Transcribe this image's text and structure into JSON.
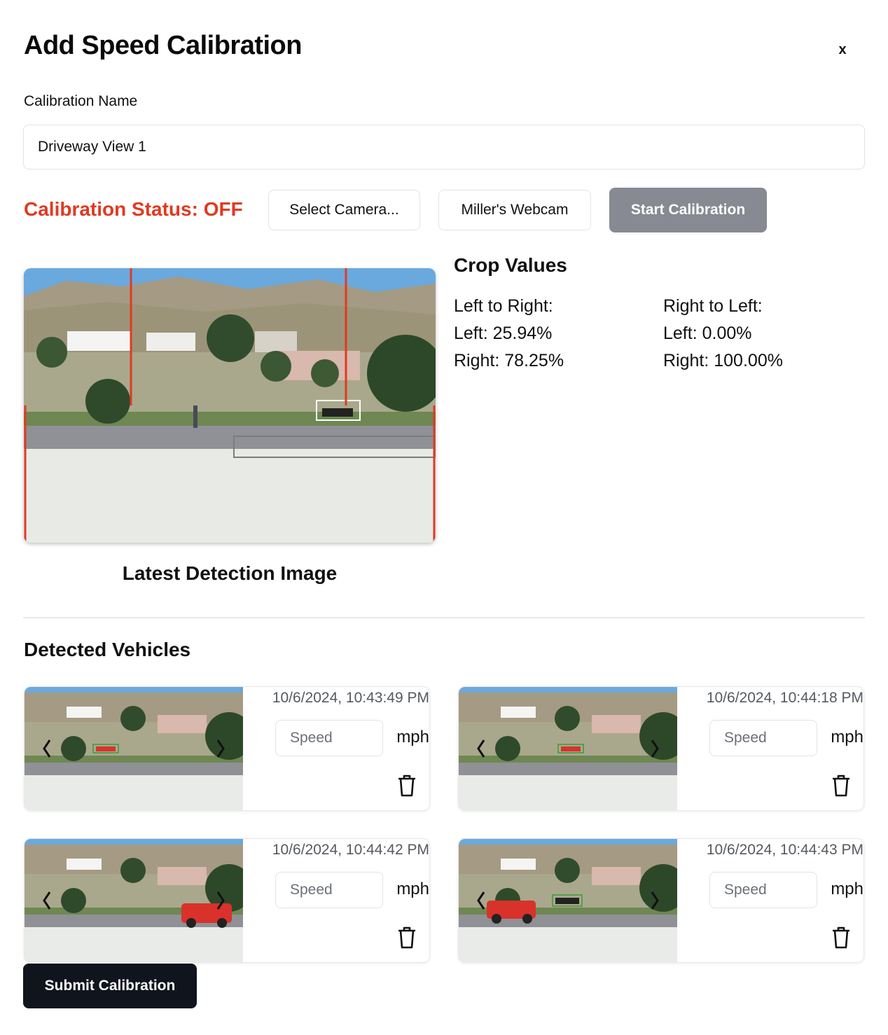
{
  "dialog": {
    "title": "Add Speed Calibration",
    "close_label": "x"
  },
  "form": {
    "name_label": "Calibration Name",
    "name_value": "Driveway View 1"
  },
  "controls": {
    "status_text": "Calibration Status: OFF",
    "status_color": "#e03a22",
    "select_camera_label": "Select Camera...",
    "camera_label": "Miller's Webcam",
    "start_label": "Start Calibration"
  },
  "detection": {
    "caption": "Latest Detection Image"
  },
  "crop": {
    "title": "Crop Values",
    "ltr_heading": "Left to Right:",
    "ltr_left": "Left: 25.94%",
    "ltr_right": "Right: 78.25%",
    "rtl_heading": "Right to Left:",
    "rtl_left": "Left: 0.00%",
    "rtl_right": "Right: 100.00%"
  },
  "vehicles": {
    "title": "Detected Vehicles",
    "speed_placeholder": "Speed",
    "unit": "mph",
    "items": [
      {
        "timestamp": "10/6/2024, 10:43:49 PM"
      },
      {
        "timestamp": "10/6/2024, 10:44:18 PM"
      },
      {
        "timestamp": "10/6/2024, 10:44:42 PM"
      },
      {
        "timestamp": "10/6/2024, 10:44:43 PM"
      }
    ]
  },
  "submit_label": "Submit Calibration"
}
